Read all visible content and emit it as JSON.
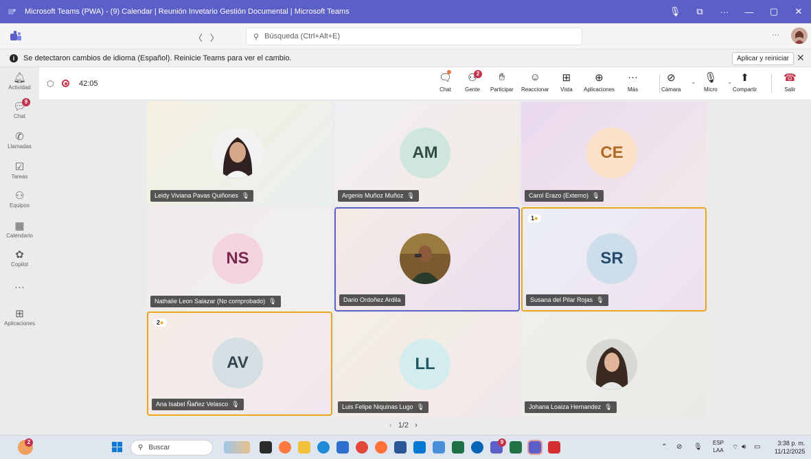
{
  "window": {
    "title": "Microsoft Teams (PWA) - (9) Calendar | Reunión Invetario Gestión Documental | Microsoft Teams",
    "controls": [
      "mic-icon",
      "cast-icon",
      "more-icon",
      "minimize-icon",
      "maximize-icon",
      "close-icon"
    ]
  },
  "search": {
    "placeholder": "Búsqueda (Ctrl+Alt+E)",
    "more": "···"
  },
  "notification": {
    "message": "Se detectaron cambios de idioma (Español). Reinicie Teams para ver el cambio.",
    "apply_label": "Aplicar y reiniciar",
    "close": "✕"
  },
  "rail": {
    "items": [
      {
        "label": "Actividad",
        "icon": "bell-icon"
      },
      {
        "label": "Chat",
        "icon": "chat-icon",
        "badge": "9"
      },
      {
        "label": "Llamadas",
        "icon": "phone-icon"
      },
      {
        "label": "Tareas",
        "icon": "tasks-icon"
      },
      {
        "label": "Equipos",
        "icon": "teams-icon"
      },
      {
        "label": "Calendario",
        "icon": "calendar-icon"
      },
      {
        "label": "Copilot",
        "icon": "copilot-icon"
      },
      {
        "label": "",
        "icon": "more-icon"
      },
      {
        "label": "Aplicaciones",
        "icon": "apps-icon"
      }
    ]
  },
  "meeting": {
    "timer": "42:05",
    "tools": [
      {
        "label": "Chat",
        "icon": "chat-icon"
      },
      {
        "label": "Gente",
        "icon": "people-icon",
        "badge": "2"
      },
      {
        "label": "Participar",
        "icon": "raise-hand-icon"
      },
      {
        "label": "Reaccionar",
        "icon": "emoji-icon"
      },
      {
        "label": "Vista",
        "icon": "view-icon"
      },
      {
        "label": "Aplicaciones",
        "icon": "apps-icon"
      },
      {
        "label": "Más",
        "icon": "more-icon"
      },
      {
        "label": "Cámara",
        "icon": "camera-off-icon"
      },
      {
        "label": "Micro",
        "icon": "mic-off-icon"
      },
      {
        "label": "Compartir",
        "icon": "share-icon"
      },
      {
        "label": "Salir",
        "icon": "hangup-icon"
      }
    ],
    "colors": {
      "accent": "#5b5fc7",
      "leave": "#c4314b",
      "hand_raise": "#e9a617"
    }
  },
  "participants": [
    {
      "name": "Leidy Viviana Pavas Quiñones",
      "initials": "",
      "photo": true,
      "muted": true
    },
    {
      "name": "Argenis Muñoz Muñoz",
      "initials": "AM",
      "photo": false,
      "muted": true,
      "color": "#cfe6dc",
      "text_color": "#2e4c44"
    },
    {
      "name": "Carol Erazo (Externo)",
      "initials": "CE",
      "photo": false,
      "muted": true,
      "color": "#fbe1c8",
      "text_color": "#b06a25"
    },
    {
      "name": "Nathalie Leon Salazar (No comprobado)",
      "initials": "NS",
      "photo": false,
      "muted": true,
      "color": "#f2d3df",
      "text_color": "#7a2a48"
    },
    {
      "name": "Dario Ordoñez Ardila",
      "initials": "",
      "photo": true,
      "muted": false,
      "active": true
    },
    {
      "name": "Susana del Pilar Rojas",
      "initials": "SR",
      "photo": false,
      "muted": true,
      "color": "#cdddea",
      "text_color": "#244a6e",
      "hand": "1"
    },
    {
      "name": "Ana Isabel Ñañez Velasco",
      "initials": "AV",
      "photo": false,
      "muted": true,
      "color": "#d4dfe4",
      "text_color": "#34454f",
      "hand": "2"
    },
    {
      "name": "Luis Felipe Niquinas Lugo",
      "initials": "LL",
      "photo": false,
      "muted": true,
      "color": "#d3ecf0",
      "text_color": "#1f5863"
    },
    {
      "name": "Johana Loaiza Hernandez",
      "initials": "",
      "photo": true,
      "muted": true
    }
  ],
  "pager": {
    "text": "1/2"
  },
  "taskbar": {
    "search_placeholder": "Buscar",
    "lang_top": "ESP",
    "lang_bottom": "LAA",
    "time": "3:38 p. m.",
    "date": "11/12/2025",
    "notification_badge": "2"
  }
}
